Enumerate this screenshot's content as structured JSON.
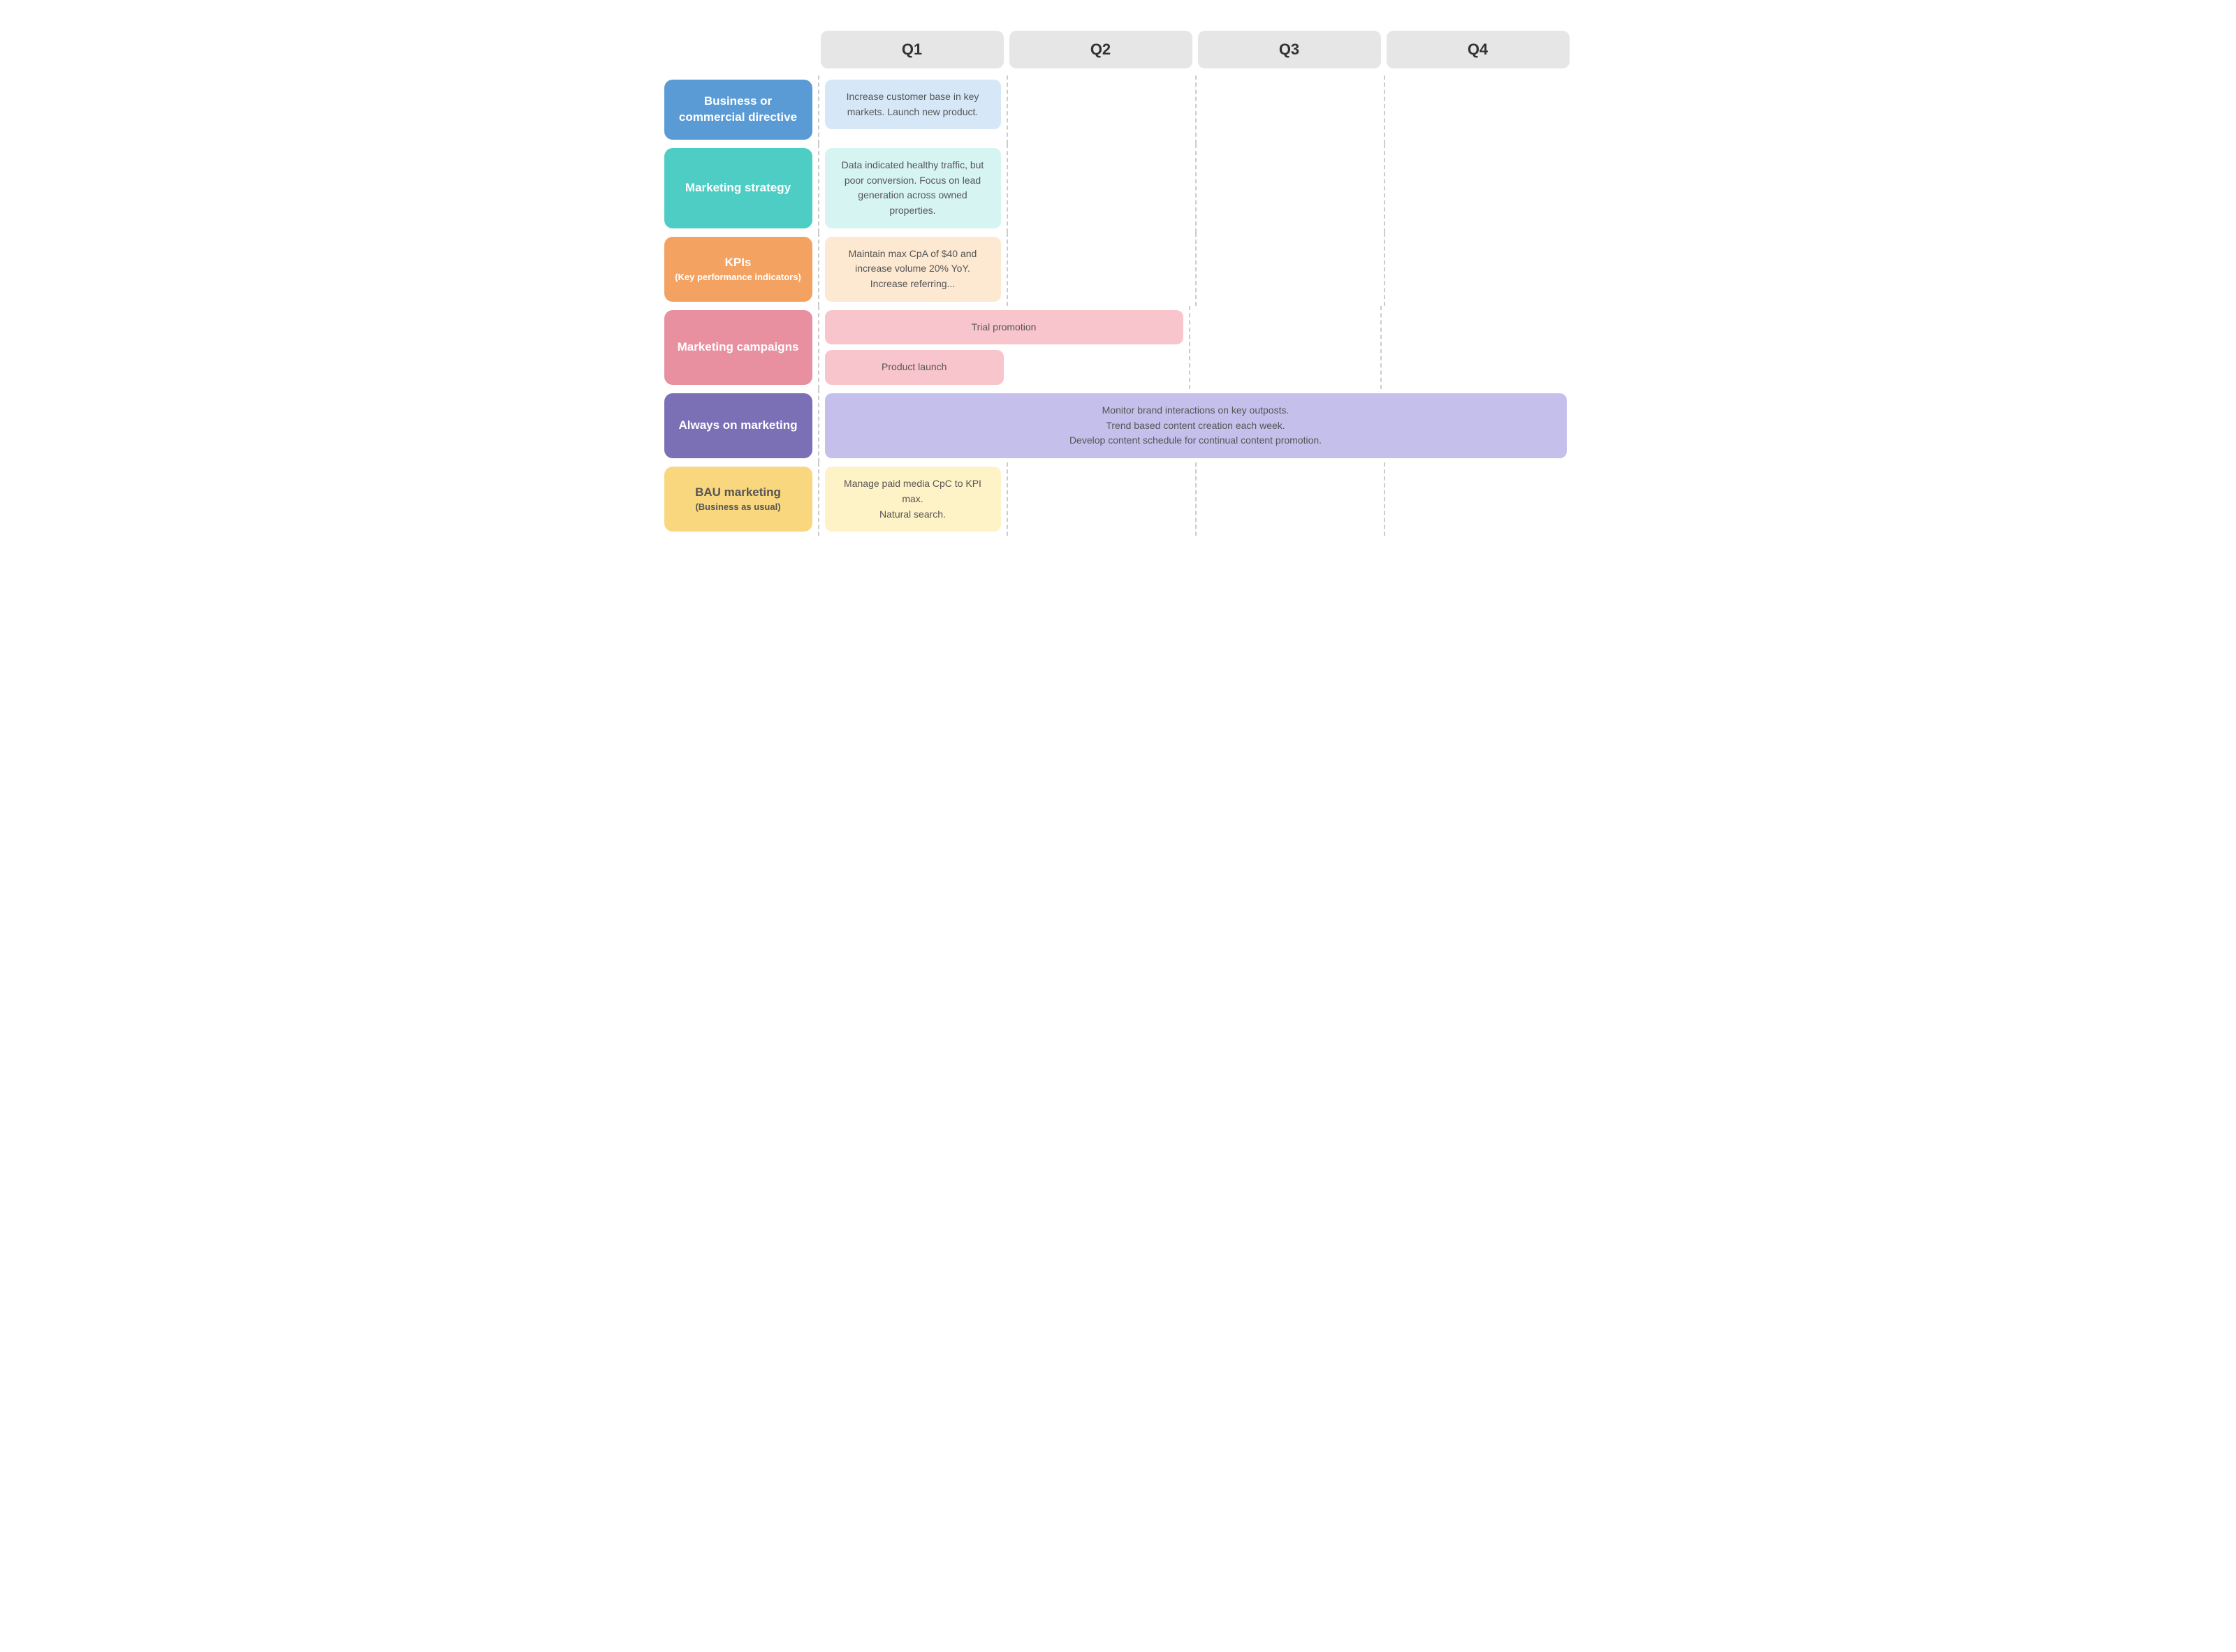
{
  "quarters": [
    "Q1",
    "Q2",
    "Q3",
    "Q4"
  ],
  "rows": [
    {
      "id": "business-directive",
      "label": "Business or commercial directive",
      "sublabel": null,
      "labelColor": "#5b9bd5",
      "textColor": "#fff",
      "cells": {
        "q1": {
          "text": "Increase customer base in key markets. Launch new product.",
          "bgColor": "#d6e8f7",
          "span": 1
        },
        "q2": null,
        "q3": null,
        "q4": null
      }
    },
    {
      "id": "marketing-strategy",
      "label": "Marketing strategy",
      "sublabel": null,
      "labelColor": "#4ecdc4",
      "textColor": "#fff",
      "cells": {
        "q1": {
          "text": "Data indicated healthy traffic, but poor conversion. Focus on lead generation across owned properties.",
          "bgColor": "#d6f4f2",
          "span": 1
        },
        "q2": null,
        "q3": null,
        "q4": null
      }
    },
    {
      "id": "kpis",
      "label": "KPIs",
      "sublabel": "(Key performance indicators)",
      "labelColor": "#f4a261",
      "textColor": "#fff",
      "cells": {
        "q1": {
          "text": "Maintain max CpA of $40 and increase volume 20% YoY.\nIncrease referring...",
          "bgColor": "#fde8d1",
          "span": 1
        },
        "q2": null,
        "q3": null,
        "q4": null
      }
    },
    {
      "id": "marketing-campaigns",
      "label": "Marketing campaigns",
      "sublabel": null,
      "labelColor": "#e88fa0",
      "textColor": "#fff",
      "subcells": [
        {
          "text": "Trial promotion",
          "bgColor": "#f9c5cc",
          "colStart": 1,
          "colSpan": 2
        },
        {
          "text": "Product launch",
          "bgColor": "#f9c5cc",
          "colStart": 1,
          "colSpan": 1
        }
      ]
    },
    {
      "id": "always-on-marketing",
      "label": "Always on marketing",
      "sublabel": null,
      "labelColor": "#7b6fb5",
      "textColor": "#fff",
      "cells": {
        "all": {
          "text": "Monitor brand interactions on key outposts.\nTrend based content creation each week.\nDevelop content schedule for continual content promotion.",
          "bgColor": "#c5bfeb",
          "span": 4
        }
      }
    },
    {
      "id": "bau-marketing",
      "label": "BAU marketing",
      "sublabel": "(Business as usual)",
      "labelColor": "#f9d77e",
      "textColor": "#555",
      "cells": {
        "q1": {
          "text": "Manage paid media CpC to KPI max.\nNatural search.",
          "bgColor": "#fef3c7",
          "span": 1
        },
        "q2": null,
        "q3": null,
        "q4": null
      }
    }
  ]
}
